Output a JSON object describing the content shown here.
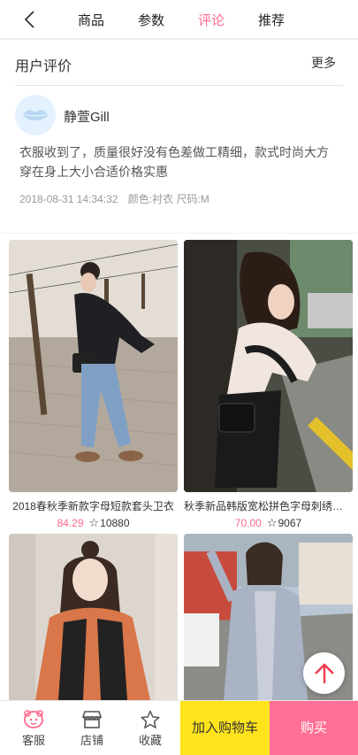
{
  "nav": {
    "tabs": [
      "商品",
      "参数",
      "评论",
      "推荐"
    ],
    "active_tab": "评论"
  },
  "review_section": {
    "title": "用户评价",
    "more": "更多",
    "user": "静萱Gill",
    "text": "衣服收到了，质量很好没有色差做工精细，款式时尚大方穿在身上大小合适价格实惠",
    "date": "2018-08-31 14:34:32",
    "spec": "颜色:衬衣 尺码:M"
  },
  "products": [
    {
      "name": "2018春秋季新款字母短款套头卫衣",
      "price": "84.29",
      "count": "10880"
    },
    {
      "name": "秋季新品韩版宽松拼色字母刺绣上衣",
      "price": "70.00",
      "count": "9067"
    }
  ],
  "bottom_bar": {
    "service": "客服",
    "shop": "店铺",
    "favorite": "收藏",
    "add_cart": "加入购物车",
    "buy": "购买"
  },
  "colors": {
    "accent": "#ff6a8d",
    "cart": "#ffe31c",
    "buy": "#ff6f96"
  },
  "icons": [
    "back-arrow-icon",
    "lips-icon",
    "star-icon",
    "arrow-up-icon",
    "service-face-icon",
    "shop-icon",
    "star-outline-icon"
  ]
}
